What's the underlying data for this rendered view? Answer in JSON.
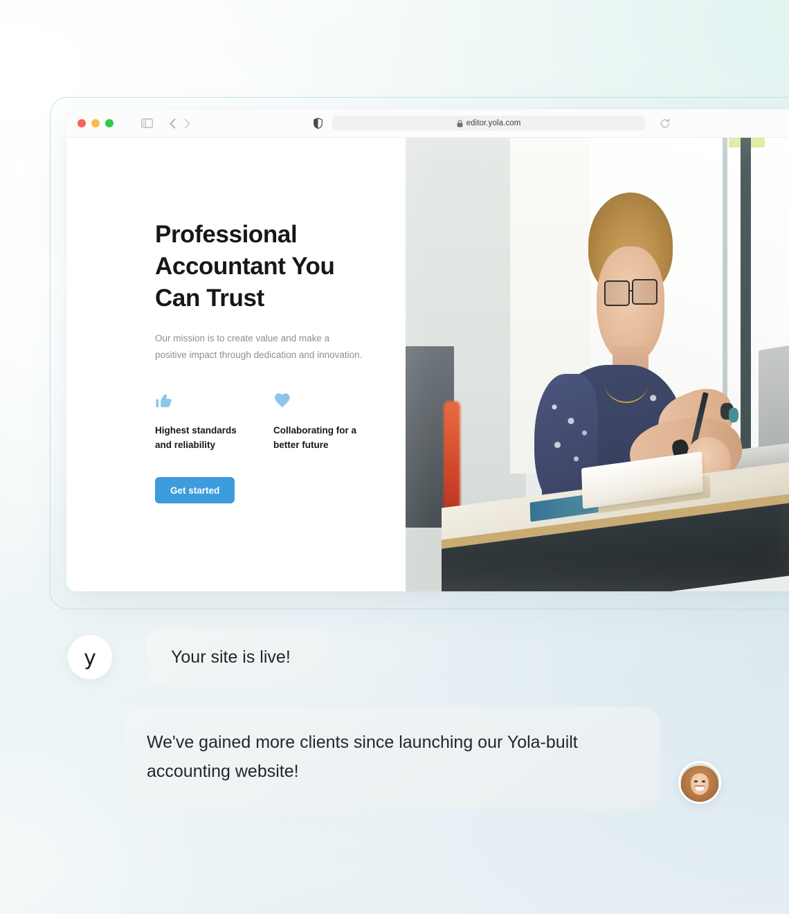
{
  "background": {
    "gradient_from": "#e2f2f0",
    "gradient_to": "#e7eff4",
    "accent_border": "#c5e0ef"
  },
  "browser": {
    "traffic_lights": [
      {
        "name": "close",
        "color": "#fc6058"
      },
      {
        "name": "minimize",
        "color": "#fdbc40"
      },
      {
        "name": "maximize",
        "color": "#34c749"
      }
    ],
    "sidebar_toggle_icon": "sidebar-icon",
    "back_icon": "chevron-left-icon",
    "forward_icon": "chevron-right-icon",
    "shield_icon": "shield-icon",
    "lock_icon": "lock-icon",
    "url": "editor.yola.com",
    "reload_icon": "reload-icon"
  },
  "site": {
    "heading": "Professional Accountant You Can Trust",
    "subtext": "Our mission is to create value and make a positive impact through dedication and innovation.",
    "features": [
      {
        "icon": "thumbs-up-icon",
        "label": "Highest standards and reliability"
      },
      {
        "icon": "heart-icon",
        "label": "Collaborating for a better future"
      }
    ],
    "cta_label": "Get started",
    "cta_color": "#3d9cdc",
    "feature_icon_color": "#8cc6ea",
    "hero_photo_alt": "Accountant writing in a notebook at a standing desk with a laptop"
  },
  "chat": {
    "messages": [
      {
        "avatar_type": "logo",
        "avatar_letter": "y",
        "text": "Your site is live!"
      },
      {
        "avatar_type": "photo",
        "avatar_alt": "Smiling client with wavy auburn hair",
        "text": "We've gained more clients since launching our Yola-built accounting website!"
      }
    ]
  }
}
